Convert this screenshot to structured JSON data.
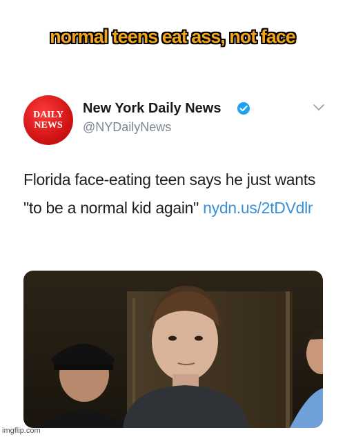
{
  "caption": "normal teens eat ass, not face",
  "tweet": {
    "avatar_lines": [
      "DAILY",
      "NEWS"
    ],
    "display_name": "New York Daily News",
    "handle": "@NYDailyNews",
    "text": "Florida face-eating teen says he just wants \"to be a normal kid again\"",
    "link": "nydn.us/2tDVdlr",
    "photo_alt": "Photo of a teen in dark shirt flanked by two men"
  },
  "colors": {
    "caption_fill": "#f2a51c",
    "link": "#3a8fd6",
    "verified": "#1da1f2",
    "avatar": "#d11414"
  },
  "watermark": "imgflip.com"
}
